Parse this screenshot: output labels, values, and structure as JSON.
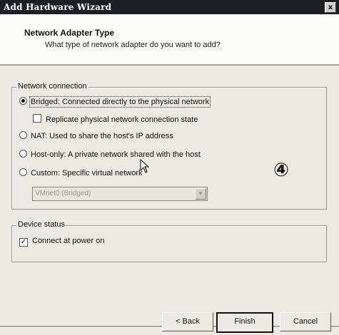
{
  "window": {
    "title": "Add Hardware Wizard",
    "close_glyph": "x"
  },
  "header": {
    "title": "Network Adapter Type",
    "subtitle": "What type of network adapter do you want to add?"
  },
  "network_connection": {
    "legend": "Network connection",
    "options": [
      {
        "label": "Bridged: Connected directly to the physical network",
        "selected": true
      },
      {
        "label": "NAT: Used to share the host's IP address",
        "selected": false
      },
      {
        "label": "Host-only: A private network shared with the host",
        "selected": false
      },
      {
        "label": "Custom: Specific virtual network",
        "selected": false
      }
    ],
    "replicate_label": "Replicate physical network connection state",
    "replicate_checked": false,
    "custom_select_value": "VMnet0 (Bridged)"
  },
  "device_status": {
    "legend": "Device status",
    "connect_label": "Connect at power on",
    "connect_checked": true,
    "check_glyph": "✓"
  },
  "step_marker": "④",
  "buttons": {
    "back": "< Back",
    "finish": "Finish",
    "cancel": "Cancel"
  }
}
